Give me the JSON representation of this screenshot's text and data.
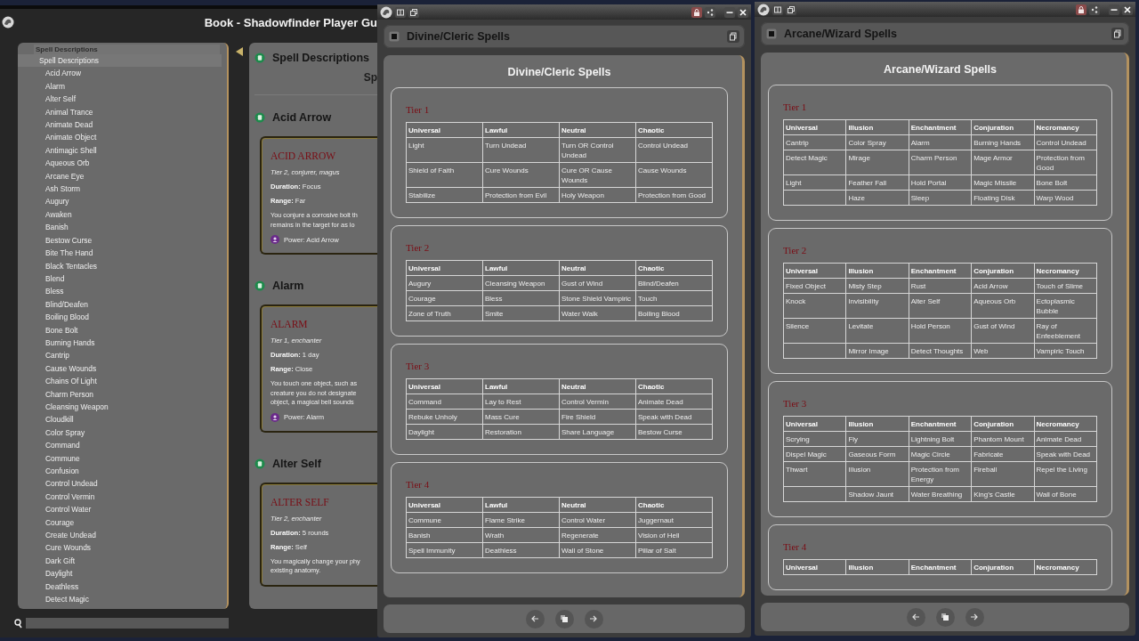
{
  "book_window": {
    "title": "Book - Shadowfinder Player Gu",
    "sidebar": {
      "header": "Spell Descriptions",
      "items": [
        {
          "label": "Spell Descriptions",
          "selected": true,
          "children": [
            {
              "label": "Acid Arrow",
              "selected": false
            },
            {
              "label": "Alarm",
              "selected": false
            },
            {
              "label": "Alter Self",
              "selected": false
            },
            {
              "label": "Animal Trance",
              "selected": false
            },
            {
              "label": "Animate Dead",
              "selected": false
            },
            {
              "label": "Animate Object",
              "selected": false
            },
            {
              "label": "Antimagic Shell",
              "selected": false
            },
            {
              "label": "Aqueous Orb",
              "selected": false
            },
            {
              "label": "Arcane Eye",
              "selected": false
            },
            {
              "label": "Ash Storm",
              "selected": false
            },
            {
              "label": "Augury",
              "selected": false
            },
            {
              "label": "Awaken",
              "selected": false
            },
            {
              "label": "Banish",
              "selected": false
            },
            {
              "label": "Bestow Curse",
              "selected": false
            },
            {
              "label": "Bite The Hand",
              "selected": false
            },
            {
              "label": "Black Tentacles",
              "selected": false
            },
            {
              "label": "Blend",
              "selected": false
            },
            {
              "label": "Bless",
              "selected": false
            },
            {
              "label": "Blind/Deafen",
              "selected": false
            },
            {
              "label": "Boiling Blood",
              "selected": false
            },
            {
              "label": "Bone Bolt",
              "selected": false
            },
            {
              "label": "Burning Hands",
              "selected": false
            },
            {
              "label": "Cantrip",
              "selected": false
            },
            {
              "label": "Cause Wounds",
              "selected": false
            },
            {
              "label": "Chains Of Light",
              "selected": false
            },
            {
              "label": "Charm Person",
              "selected": false
            },
            {
              "label": "Cleansing Weapon",
              "selected": false
            },
            {
              "label": "Cloudkill",
              "selected": false
            },
            {
              "label": "Color Spray",
              "selected": false
            },
            {
              "label": "Command",
              "selected": false
            },
            {
              "label": "Commune",
              "selected": false
            },
            {
              "label": "Confusion",
              "selected": false
            },
            {
              "label": "Control Undead",
              "selected": false
            },
            {
              "label": "Control Vermin",
              "selected": false
            },
            {
              "label": "Control Water",
              "selected": false
            },
            {
              "label": "Courage",
              "selected": false
            },
            {
              "label": "Create Undead",
              "selected": false
            },
            {
              "label": "Cure Wounds",
              "selected": false
            },
            {
              "label": "Dark Gift",
              "selected": false
            },
            {
              "label": "Daylight",
              "selected": false
            },
            {
              "label": "Deathless",
              "selected": false
            },
            {
              "label": "Detect Magic",
              "selected": false
            }
          ]
        }
      ]
    },
    "content": {
      "sections": [
        {
          "heading": "Spell Descriptions",
          "subheading": "Sp"
        },
        {
          "heading": "Acid Arrow",
          "card": {
            "title": "ACID ARROW",
            "meta": "Tier 2, conjurer, magus",
            "details": [
              "**Duration:** Focus",
              "**Range:** Far"
            ],
            "lines": [
              "You conjure a corrosive bolt th",
              "remains in the target for as lo"
            ],
            "power": "Power: Acid Arrow"
          }
        },
        {
          "heading": "Alarm",
          "card": {
            "title": "ALARM",
            "meta": "Tier 1, enchanter",
            "details": [
              "**Duration:** 1 day",
              "**Range:** Close"
            ],
            "lines": [
              "You touch one object, such as",
              "creature you do not designate",
              "object, a magical bell sounds"
            ],
            "power": "Power: Alarm"
          }
        },
        {
          "heading": "Alter Self",
          "card": {
            "title": "ALTER SELF",
            "meta": "Tier 2, enchanter",
            "details": [
              "**Duration:** 5 rounds",
              "**Range:** Self"
            ],
            "lines": [
              "You magically change your phy",
              "existing anatomy."
            ]
          }
        }
      ]
    }
  },
  "spell_windows": [
    {
      "title": "Divine/Cleric Spells",
      "heading": "Divine/Cleric Spells",
      "tiers": [
        {
          "title": "Tier 1",
          "columns": [
            "Universal",
            "Lawful",
            "Neutral",
            "Chaotic"
          ],
          "rows": [
            [
              "Light",
              "Turn Undead",
              "Turn OR Control Undead",
              "Control Undead"
            ],
            [
              "Shield of Faith",
              "Cure Wounds",
              "Cure OR Cause Wounds",
              "Cause Wounds"
            ],
            [
              "Stabilize",
              "Protection from Evil",
              "Holy Weapon",
              "Protection from Good"
            ]
          ]
        },
        {
          "title": "Tier 2",
          "columns": [
            "Universal",
            "Lawful",
            "Neutral",
            "Chaotic"
          ],
          "rows": [
            [
              "Augury",
              "Cleansing Weapon",
              "Gust of Wind",
              "Blind/Deafen"
            ],
            [
              "Courage",
              "Bless",
              "Stone Shield Vampiric",
              "Touch"
            ],
            [
              "Zone of Truth",
              "Smite",
              "Water Walk",
              "Boiling Blood"
            ]
          ]
        },
        {
          "title": "Tier 3",
          "columns": [
            "Universal",
            "Lawful",
            "Neutral",
            "Chaotic"
          ],
          "rows": [
            [
              "Command",
              "Lay to Rest",
              "Control Vermin",
              "Animate Dead"
            ],
            [
              "Rebuke Unholy",
              "Mass Cure",
              "Fire Shield",
              "Speak with Dead"
            ],
            [
              "Daylight",
              "Restoration",
              "Share Language",
              "Bestow Curse"
            ]
          ]
        },
        {
          "title": "Tier 4",
          "columns": [
            "Universal",
            "Lawful",
            "Neutral",
            "Chaotic"
          ],
          "rows": [
            [
              "Commune",
              "Flame Strike",
              "Control Water",
              "Juggernaut"
            ],
            [
              "Banish",
              "Wrath",
              "Regenerate",
              "Vision of Hell"
            ],
            [
              "Spell Immunity",
              "Deathless",
              "Wall of Stone",
              "Pillar of Salt"
            ]
          ]
        }
      ]
    },
    {
      "title": "Arcane/Wizard Spells",
      "heading": "Arcane/Wizard Spells",
      "tiers": [
        {
          "title": "Tier 1",
          "columns": [
            "Universal",
            "Illusion",
            "Enchantment",
            "Conjuration",
            "Necromancy"
          ],
          "rows": [
            [
              "Cantrip",
              "Color Spray",
              "Alarm",
              "Burning Hands",
              "Control Undead"
            ],
            [
              "Detect Magic",
              "Mirage",
              "Charm Person",
              "Mage Armor",
              "Protection from Good"
            ],
            [
              "Light",
              "Feather Fall",
              "Hold Portal",
              "Magic Missile",
              "Bone Bolt"
            ],
            [
              null,
              "Haze",
              "Sleep",
              "Floating Disk",
              "Warp Wood"
            ]
          ]
        },
        {
          "title": "Tier 2",
          "columns": [
            "Universal",
            "Illusion",
            "Enchantment",
            "Conjuration",
            "Necromancy"
          ],
          "rows": [
            [
              "Fixed Object",
              "Misty Step",
              "Rust",
              "Acid Arrow",
              "Touch of Slime"
            ],
            [
              "Knock",
              "Invisibility",
              "Alter Self",
              "Aqueous Orb",
              "Ectoplasmic Bubble"
            ],
            [
              "Silence",
              "Levitate",
              "Hold Person",
              "Gust of Wind",
              "Ray of Enfeeblement"
            ],
            [
              null,
              "Mirror Image",
              "Detect Thoughts",
              "Web",
              "Vampiric Touch"
            ]
          ]
        },
        {
          "title": "Tier 3",
          "columns": [
            "Universal",
            "Illusion",
            "Enchantment",
            "Conjuration",
            "Necromancy"
          ],
          "rows": [
            [
              "Scrying",
              "Fly",
              "Lightning Bolt",
              "Phantom Mount",
              "Animate Dead"
            ],
            [
              "Dispel Magic",
              "Gaseous Form",
              "Magic Circle",
              "Fabricate",
              "Speak with Dead"
            ],
            [
              "Thwart",
              "Illusion",
              "Protection from Energy",
              "Fireball",
              "Repel the Living"
            ],
            [
              null,
              "Shadow Jaunt",
              "Water Breathing",
              "King's Castle",
              "Wall of Bone"
            ]
          ]
        },
        {
          "title": "Tier 4",
          "columns": [
            "Universal",
            "Illusion",
            "Enchantment",
            "Conjuration",
            "Necromancy"
          ]
        }
      ]
    }
  ]
}
